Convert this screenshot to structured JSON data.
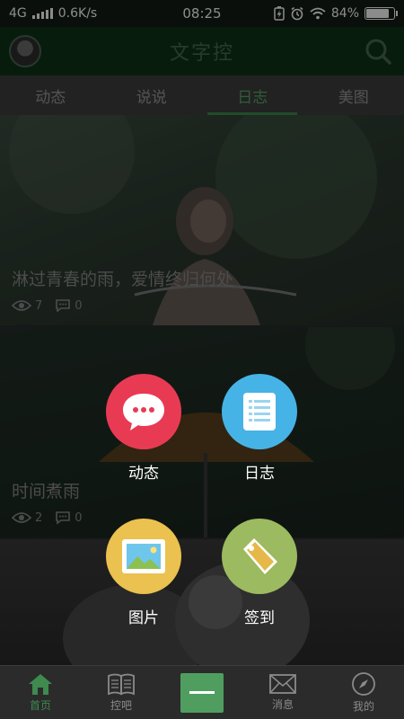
{
  "status": {
    "network": "4G",
    "speed": "0.6K/s",
    "time": "08:25",
    "battery": "84%",
    "battery_level": 0.84
  },
  "header": {
    "title": "文字控"
  },
  "tabs": [
    {
      "label": "动态"
    },
    {
      "label": "说说"
    },
    {
      "label": "日志"
    },
    {
      "label": "美图"
    }
  ],
  "feed": [
    {
      "title": "淋过青春的雨，爱情终归何处",
      "views": "7",
      "comments": "0"
    },
    {
      "title": "时间煮雨",
      "views": "2",
      "comments": "0"
    }
  ],
  "actions": [
    {
      "label": "动态",
      "icon": "chat-bubble-icon",
      "color": "#e93a54"
    },
    {
      "label": "日志",
      "icon": "document-icon",
      "color": "#46b3e6"
    },
    {
      "label": "图片",
      "icon": "picture-icon",
      "color": "#ebc14f"
    },
    {
      "label": "签到",
      "icon": "tag-icon",
      "color": "#9cba5f"
    }
  ],
  "bottom_nav": [
    {
      "label": "首页",
      "icon": "home-icon"
    },
    {
      "label": "控吧",
      "icon": "book-icon"
    },
    {
      "label": "消息",
      "icon": "mail-icon"
    },
    {
      "label": "我的",
      "icon": "compass-icon"
    }
  ],
  "colors": {
    "accent": "#3e8a4f",
    "header_bg": "#10331a"
  }
}
